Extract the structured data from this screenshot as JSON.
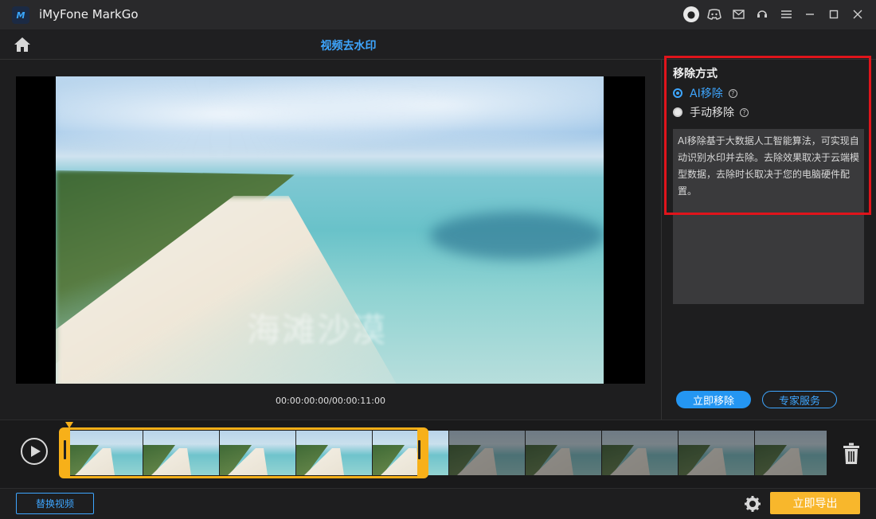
{
  "app": {
    "title": "iMyFone MarkGo",
    "logo_text": "M"
  },
  "window_controls": [
    "avatar-icon",
    "discord-icon",
    "mail-icon",
    "support-icon",
    "menu-icon",
    "minimize-icon",
    "maximize-icon",
    "close-icon"
  ],
  "header": {
    "page_title": "视频去水印"
  },
  "preview": {
    "time_display": "00:00:00:00/00:00:11:00",
    "watermark_text": "海滩沙漠"
  },
  "panel": {
    "heading": "移除方式",
    "options": [
      {
        "label": "AI移除",
        "selected": true,
        "help": "?"
      },
      {
        "label": "手动移除",
        "selected": false,
        "help": "?"
      }
    ],
    "description": "AI移除基于大数据人工智能算法，可实现自动识别水印并去除。去除效果取决于云端模型数据，去除时长取决于您的电脑硬件配置。",
    "remove_button": "立即移除",
    "expert_button": "专家服务"
  },
  "timeline": {
    "thumbnail_count": 10,
    "selected_thumbnails": 5
  },
  "footer": {
    "replace_button": "替换视频",
    "export_button": "立即导出"
  },
  "colors": {
    "accent": "#3ea6ff",
    "primary_button": "#2496f2",
    "export": "#f8b72c",
    "selection": "#f7b019",
    "highlight_box": "#e0141b"
  }
}
